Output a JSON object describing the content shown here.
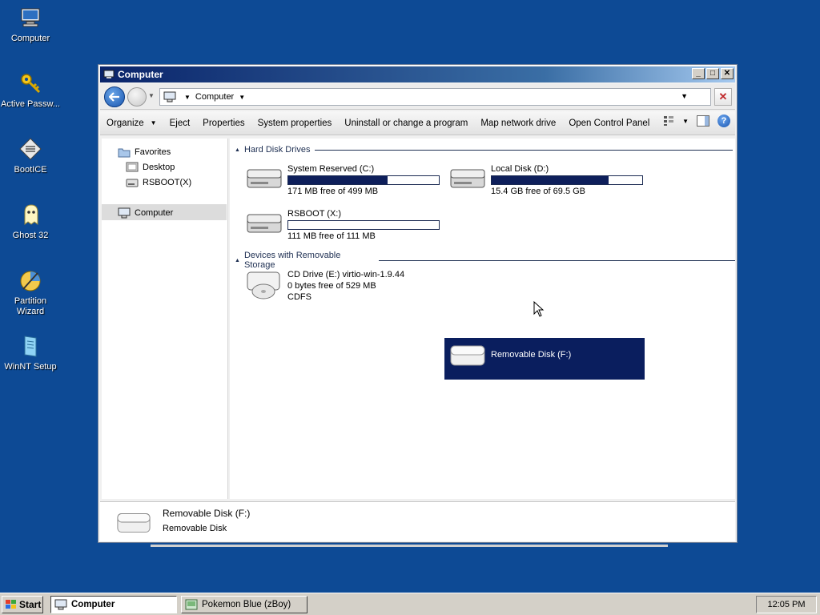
{
  "desktop": {
    "icons": [
      {
        "label": "Computer",
        "icon": "computer-icon"
      },
      {
        "label": "Active Passw...",
        "icon": "key-icon"
      },
      {
        "label": "BootICE",
        "icon": "bootice-icon"
      },
      {
        "label": "Ghost 32",
        "icon": "ghost-icon"
      },
      {
        "label": "Partition Wizard",
        "icon": "partition-wizard-icon"
      },
      {
        "label": "WinNT Setup",
        "icon": "winnt-setup-icon"
      }
    ]
  },
  "window": {
    "title": "Computer",
    "controls": {
      "minimize": "_",
      "maximize": "□",
      "close": "✕"
    },
    "address": {
      "location": "Computer"
    },
    "toolbar": {
      "organize": "Organize",
      "eject": "Eject",
      "properties": "Properties",
      "system_properties": "System properties",
      "uninstall": "Uninstall or change a program",
      "map_drive": "Map network drive",
      "control_panel": "Open Control Panel",
      "help": "?"
    },
    "nav": {
      "favorites": "Favorites",
      "desktop": "Desktop",
      "rsboot": "RSBOOT(X)",
      "computer": "Computer"
    },
    "groups": {
      "hdd": "Hard Disk Drives",
      "removable": "Devices with Removable Storage"
    },
    "drives": {
      "c": {
        "name": "System Reserved (C:)",
        "free": "171 MB free of 499 MB",
        "used_fraction": 0.657
      },
      "d": {
        "name": "Local Disk (D:)",
        "free": "15.4 GB free of 69.5 GB",
        "used_fraction": 0.778
      },
      "x": {
        "name": "RSBOOT (X:)",
        "free": "111 MB free of 111 MB",
        "used_fraction": 0.0
      },
      "e": {
        "name": "CD Drive (E:) virtio-win-1.9.44",
        "free": "0 bytes free of 529 MB",
        "fs": "CDFS"
      },
      "f": {
        "name": "Removable Disk (F:)"
      }
    },
    "details": {
      "name": "Removable Disk (F:)",
      "type": "Removable Disk"
    }
  },
  "taskbar": {
    "start": "Start",
    "tasks": [
      "Computer",
      "Pokemon Blue (zBoy)"
    ],
    "clock": "12:05 PM"
  },
  "colors": {
    "desktop": "#0d4a95",
    "selection": "#0a1e5e",
    "bar_fill": "#0e1f5b"
  }
}
